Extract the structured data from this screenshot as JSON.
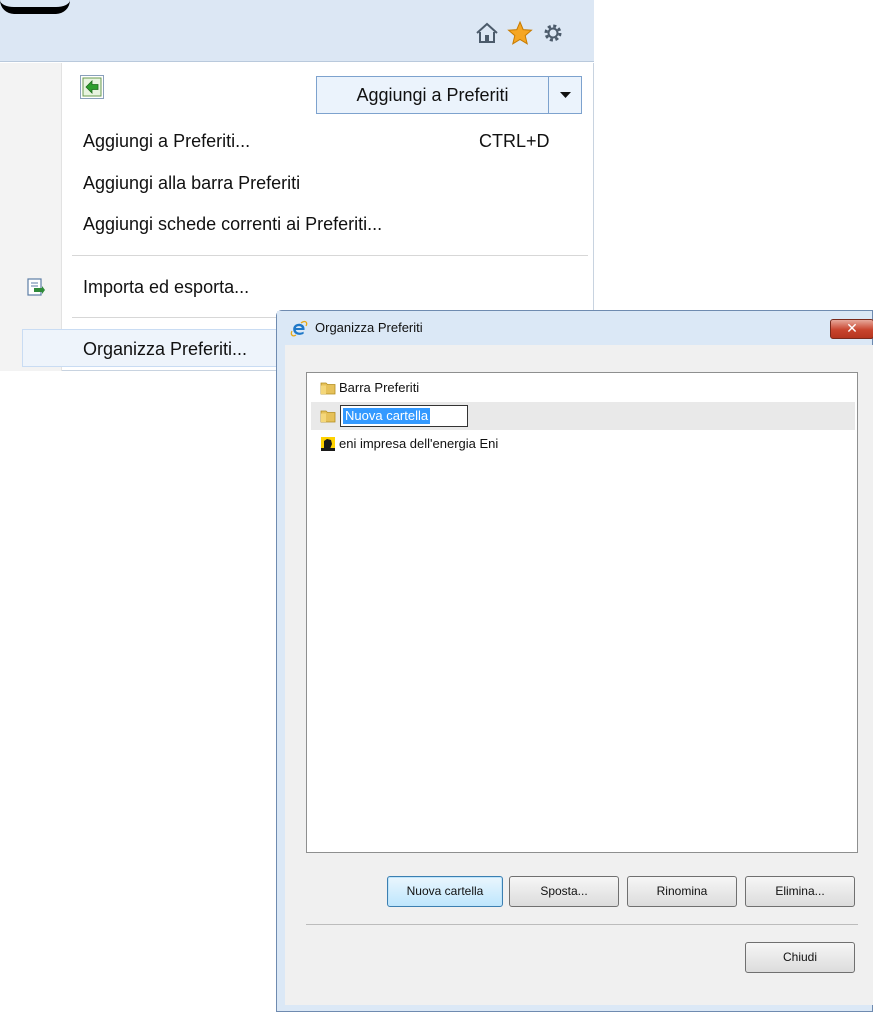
{
  "favorites_menu": {
    "add_button_label": "Aggiungi a Preferiti",
    "items": [
      {
        "label": "Aggiungi a Preferiti...",
        "shortcut": "CTRL+D"
      },
      {
        "label": "Aggiungi alla barra Preferiti"
      },
      {
        "label": "Aggiungi schede correnti ai Preferiti..."
      },
      {
        "label": "Importa ed esporta..."
      },
      {
        "label": "Organizza Preferiti..."
      }
    ],
    "icons": {
      "home": "home-icon",
      "favorites": "star-icon",
      "tools": "gear-icon",
      "back": "green-arrow-left-icon",
      "dropdown": "chevron-down-icon",
      "import_export": "import-export-icon"
    }
  },
  "dialog": {
    "title": "Organizza Preferiti",
    "list_items": [
      {
        "label": "Barra Preferiti",
        "icon": "folder-icon"
      },
      {
        "label": "Nuova cartella",
        "icon": "folder-icon",
        "editing": true
      },
      {
        "label": "eni impresa dell'energia  Eni",
        "icon": "eni-favicon-icon"
      }
    ],
    "buttons": {
      "new_folder": "Nuova cartella",
      "move": "Sposta...",
      "rename": "Rinomina",
      "delete": "Elimina...",
      "close": "Chiudi"
    }
  },
  "colors": {
    "toolbar": "#dce7f4",
    "accent_blue": "#3399ff",
    "star": "#f5a623",
    "close_red": "#c8442d"
  }
}
